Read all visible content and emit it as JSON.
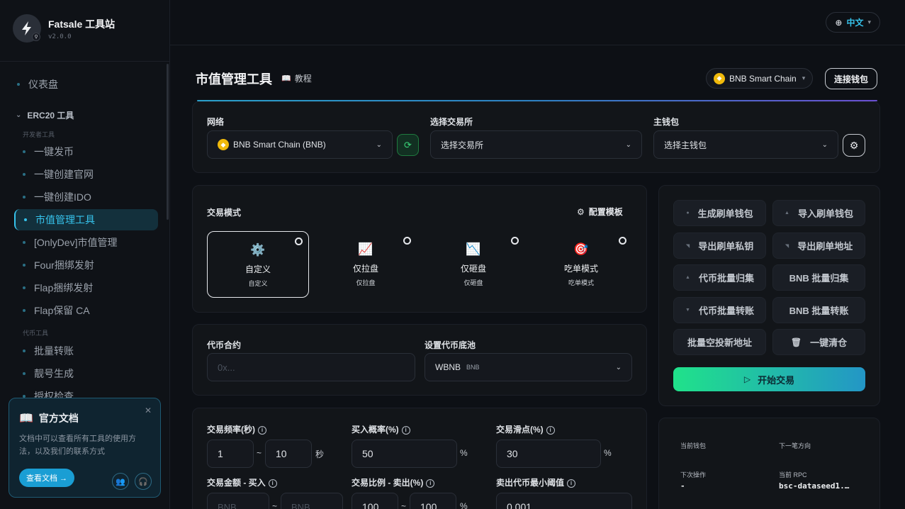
{
  "brand": {
    "name": "Fatsale 工具站",
    "version": "v2.0.0"
  },
  "sidebar": {
    "dashboard": "仪表盘",
    "group": "ERC20 工具",
    "dev_section": "开发者工具",
    "dev_items": [
      "一键发币",
      "一键创建官网",
      "一键创建IDO",
      "市值管理工具",
      "[OnlyDev]市值管理",
      "Four捆绑发射",
      "Flap捆绑发射",
      "Flap保留 CA"
    ],
    "token_section": "代币工具",
    "token_items": [
      "批量转账",
      "靓号生成",
      "授权检查"
    ]
  },
  "doc_card": {
    "title": "官方文档",
    "desc": "文档中可以查看所有工具的使用方法，以及我们的联系方式",
    "button": "查看文档 →"
  },
  "topbar": {
    "lang": "中文"
  },
  "header": {
    "title": "市值管理工具",
    "tutorial": "教程",
    "chain": "BNB Smart Chain",
    "connect": "连接钱包"
  },
  "config": {
    "network_label": "网络",
    "network_value": "BNB Smart Chain (BNB)",
    "exchange_label": "选择交易所",
    "exchange_value": "选择交易所",
    "wallet_label": "主钱包",
    "wallet_value": "选择主钱包"
  },
  "modes": {
    "label": "交易模式",
    "template_btn": "配置模板",
    "items": [
      {
        "icon": "⚙️",
        "name": "自定义",
        "sub": "自定义"
      },
      {
        "icon": "📈",
        "name": "仅拉盘",
        "sub": "仅拉盘"
      },
      {
        "icon": "📉",
        "name": "仅砸盘",
        "sub": "仅砸盘"
      },
      {
        "icon": "🎯",
        "name": "吃单模式",
        "sub": "吃单模式"
      }
    ]
  },
  "token": {
    "contract_label": "代币合约",
    "contract_placeholder": "0x...",
    "pool_label": "设置代币底池",
    "pool_value": "WBNB",
    "pool_tag": "BNB"
  },
  "params": {
    "freq_label": "交易频率(秒)",
    "freq_min": "1",
    "freq_sep": "~",
    "freq_max": "10",
    "freq_unit": "秒",
    "buy_prob_label": "买入概率(%)",
    "buy_prob": "50",
    "slip_label": "交易滑点(%)",
    "slip": "30",
    "pct": "%",
    "amount_label": "交易金额 - 买入",
    "amount_min_ph": "BNB",
    "amount_max_ph": "BNB",
    "ratio_label": "交易比例 - 卖出(%)",
    "ratio_min": "100",
    "ratio_max": "100",
    "threshold_label": "卖出代币最小阈值",
    "threshold": "0.001"
  },
  "actions": [
    "生成刷单钱包",
    "导入刷单钱包",
    "导出刷单私钥",
    "导出刷单地址",
    "代币批量归集",
    "BNB 批量归集",
    "代币批量转账",
    "BNB 批量转账",
    "批量空投新地址",
    "一键清仓"
  ],
  "start": "开始交易",
  "status": {
    "current_wallet": "当前钱包",
    "next_direction": "下一笔方向",
    "next_action": "下次操作",
    "next_action_value": "-",
    "current_rpc": "当前 RPC",
    "current_rpc_value": "bsc-dataseed1.…"
  }
}
